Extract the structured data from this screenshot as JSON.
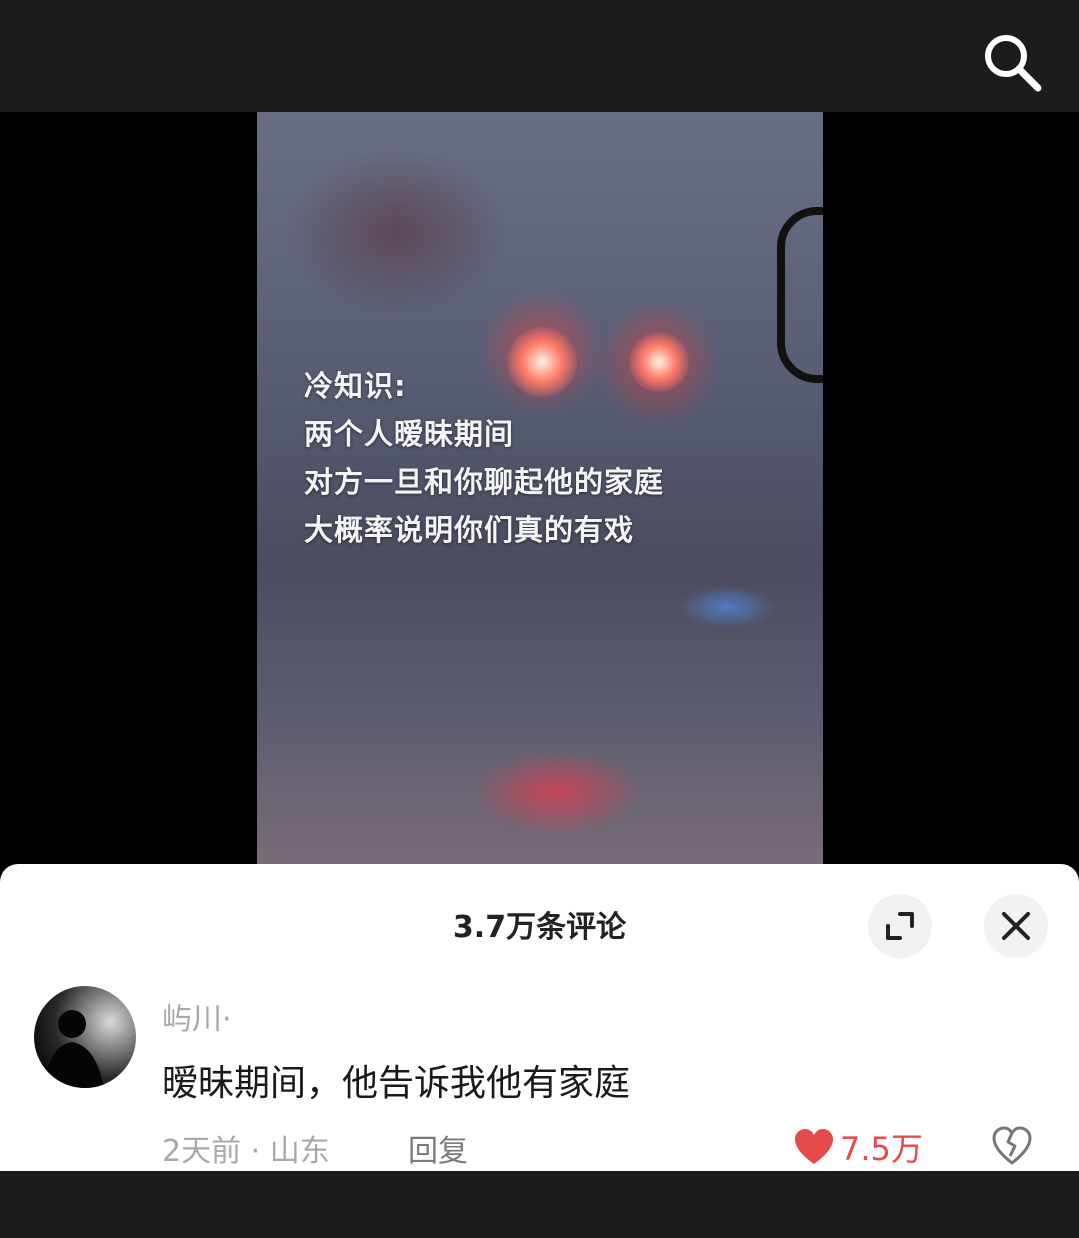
{
  "video": {
    "caption_lines": [
      "冷知识:",
      "两个人暧昧期间",
      "对方一旦和你聊起他的家庭",
      "大概率说明你们真的有戏"
    ]
  },
  "comments_sheet": {
    "title": "3.7万条评论",
    "comment": {
      "username": "屿川·",
      "text": "暧昧期间，他告诉我他有家庭",
      "meta": "2天前 · 山东",
      "reply_label": "回复",
      "like_count": "7.5万"
    }
  },
  "icons": {
    "search": "search-icon",
    "expand": "expand-icon",
    "close": "close-icon",
    "like": "heart-icon",
    "dislike": "broken-heart-icon"
  },
  "colors": {
    "like": "#e64b4b",
    "sheet_bg": "#ffffff",
    "meta_text": "#a8a8a8"
  }
}
